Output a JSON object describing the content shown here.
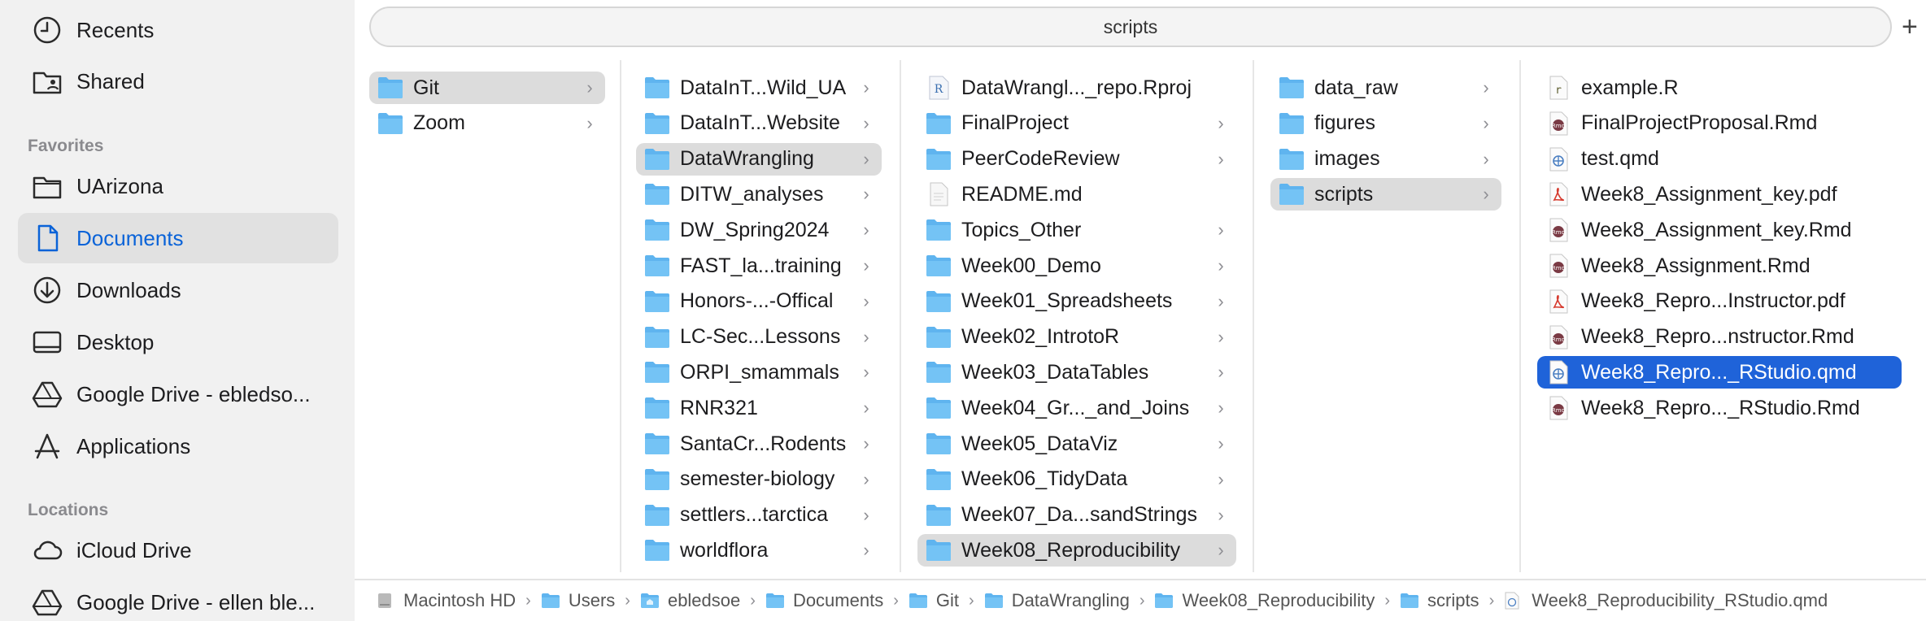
{
  "sidebar": {
    "top_items": [
      {
        "label": "Recents",
        "icon": "clock-icon"
      },
      {
        "label": "Shared",
        "icon": "shared-folder-icon"
      }
    ],
    "favorites_heading": "Favorites",
    "favorites": [
      {
        "label": "UArizona",
        "icon": "folder-icon",
        "selected": false
      },
      {
        "label": "Documents",
        "icon": "document-icon",
        "selected": true
      },
      {
        "label": "Downloads",
        "icon": "download-icon",
        "selected": false
      },
      {
        "label": "Desktop",
        "icon": "desktop-icon",
        "selected": false
      },
      {
        "label": "Google Drive - ebledso...",
        "icon": "google-drive-icon",
        "selected": false
      },
      {
        "label": "Applications",
        "icon": "applications-icon",
        "selected": false
      }
    ],
    "locations_heading": "Locations",
    "locations": [
      {
        "label": "iCloud Drive",
        "icon": "cloud-icon"
      },
      {
        "label": "Google Drive - ellen ble...",
        "icon": "google-drive-icon"
      }
    ]
  },
  "toolbar": {
    "path_title": "scripts",
    "plus_label": "+"
  },
  "columns": [
    {
      "items": [
        {
          "name": "Git",
          "type": "folder",
          "has_children": true,
          "state": "gray"
        },
        {
          "name": "Zoom",
          "type": "folder",
          "has_children": true,
          "state": "none"
        }
      ]
    },
    {
      "items": [
        {
          "name": "DataInT...Wild_UA",
          "type": "folder",
          "has_children": true,
          "state": "none"
        },
        {
          "name": "DataInT...Website",
          "type": "folder",
          "has_children": true,
          "state": "none"
        },
        {
          "name": "DataWrangling",
          "type": "folder",
          "has_children": true,
          "state": "gray"
        },
        {
          "name": "DITW_analyses",
          "type": "folder",
          "has_children": true,
          "state": "none"
        },
        {
          "name": "DW_Spring2024",
          "type": "folder",
          "has_children": true,
          "state": "none"
        },
        {
          "name": "FAST_la...training",
          "type": "folder",
          "has_children": true,
          "state": "none"
        },
        {
          "name": "Honors-...-Offical",
          "type": "folder",
          "has_children": true,
          "state": "none"
        },
        {
          "name": "LC-Sec...Lessons",
          "type": "folder",
          "has_children": true,
          "state": "none"
        },
        {
          "name": "ORPI_smammals",
          "type": "folder",
          "has_children": true,
          "state": "none"
        },
        {
          "name": "RNR321",
          "type": "folder",
          "has_children": true,
          "state": "none"
        },
        {
          "name": "SantaCr...Rodents",
          "type": "folder",
          "has_children": true,
          "state": "none"
        },
        {
          "name": "semester-biology",
          "type": "folder",
          "has_children": true,
          "state": "none"
        },
        {
          "name": "settlers...tarctica",
          "type": "folder",
          "has_children": true,
          "state": "none"
        },
        {
          "name": "worldflora",
          "type": "folder",
          "has_children": true,
          "state": "none"
        }
      ]
    },
    {
      "items": [
        {
          "name": "DataWrangl..._repo.Rproj",
          "type": "rproj",
          "has_children": false,
          "state": "none"
        },
        {
          "name": "FinalProject",
          "type": "folder",
          "has_children": true,
          "state": "none"
        },
        {
          "name": "PeerCodeReview",
          "type": "folder",
          "has_children": true,
          "state": "none"
        },
        {
          "name": "README.md",
          "type": "text",
          "has_children": false,
          "state": "none"
        },
        {
          "name": "Topics_Other",
          "type": "folder",
          "has_children": true,
          "state": "none"
        },
        {
          "name": "Week00_Demo",
          "type": "folder",
          "has_children": true,
          "state": "none"
        },
        {
          "name": "Week01_Spreadsheets",
          "type": "folder",
          "has_children": true,
          "state": "none"
        },
        {
          "name": "Week02_IntrotoR",
          "type": "folder",
          "has_children": true,
          "state": "none"
        },
        {
          "name": "Week03_DataTables",
          "type": "folder",
          "has_children": true,
          "state": "none"
        },
        {
          "name": "Week04_Gr..._and_Joins",
          "type": "folder",
          "has_children": true,
          "state": "none"
        },
        {
          "name": "Week05_DataViz",
          "type": "folder",
          "has_children": true,
          "state": "none"
        },
        {
          "name": "Week06_TidyData",
          "type": "folder",
          "has_children": true,
          "state": "none"
        },
        {
          "name": "Week07_Da...sandStrings",
          "type": "folder",
          "has_children": true,
          "state": "none"
        },
        {
          "name": "Week08_Reproducibility",
          "type": "folder",
          "has_children": true,
          "state": "gray"
        }
      ]
    },
    {
      "items": [
        {
          "name": "data_raw",
          "type": "folder",
          "has_children": true,
          "state": "none"
        },
        {
          "name": "figures",
          "type": "folder",
          "has_children": true,
          "state": "none"
        },
        {
          "name": "images",
          "type": "folder",
          "has_children": true,
          "state": "none"
        },
        {
          "name": "scripts",
          "type": "folder",
          "has_children": true,
          "state": "gray"
        }
      ]
    },
    {
      "items": [
        {
          "name": "example.R",
          "type": "r",
          "has_children": false,
          "state": "none"
        },
        {
          "name": "FinalProjectProposal.Rmd",
          "type": "rmd",
          "has_children": false,
          "state": "none"
        },
        {
          "name": "test.qmd",
          "type": "qmd",
          "has_children": false,
          "state": "none"
        },
        {
          "name": "Week8_Assignment_key.pdf",
          "type": "pdf",
          "has_children": false,
          "state": "none"
        },
        {
          "name": "Week8_Assignment_key.Rmd",
          "type": "rmd",
          "has_children": false,
          "state": "none"
        },
        {
          "name": "Week8_Assignment.Rmd",
          "type": "rmd",
          "has_children": false,
          "state": "none"
        },
        {
          "name": "Week8_Repro...Instructor.pdf",
          "type": "pdf",
          "has_children": false,
          "state": "none"
        },
        {
          "name": "Week8_Repro...nstructor.Rmd",
          "type": "rmd",
          "has_children": false,
          "state": "none"
        },
        {
          "name": "Week8_Repro..._RStudio.qmd",
          "type": "qmd",
          "has_children": false,
          "state": "blue"
        },
        {
          "name": "Week8_Repro..._RStudio.Rmd",
          "type": "rmd",
          "has_children": false,
          "state": "none"
        }
      ]
    }
  ],
  "pathbar": {
    "crumbs": [
      {
        "label": "Macintosh HD",
        "icon": "hard-drive-icon"
      },
      {
        "label": "Users",
        "icon": "folder-icon"
      },
      {
        "label": "ebledsoe",
        "icon": "home-folder-icon"
      },
      {
        "label": "Documents",
        "icon": "folder-icon"
      },
      {
        "label": "Git",
        "icon": "folder-icon"
      },
      {
        "label": "DataWrangling",
        "icon": "folder-icon"
      },
      {
        "label": "Week08_Reproducibility",
        "icon": "folder-icon"
      },
      {
        "label": "scripts",
        "icon": "folder-icon"
      },
      {
        "label": "Week8_Reproducibility_RStudio.qmd",
        "icon": "qmd-file-icon"
      }
    ],
    "separator": "›"
  },
  "colors": {
    "accent": "#1f63d9",
    "folder": "#5fb4ef",
    "sidebar_bg": "#f1f1f1",
    "selected_gray": "#dcdcdc"
  }
}
